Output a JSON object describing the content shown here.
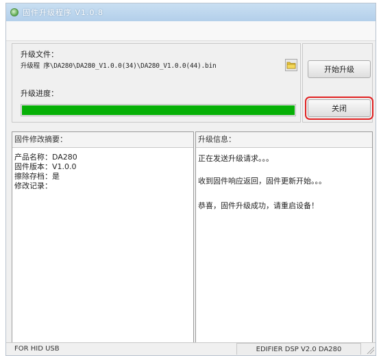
{
  "window": {
    "title": "固件升级程序  V1.0.8"
  },
  "upgrade": {
    "file_label": "升级文件：",
    "file_path": "升级程 序\\DA280\\DA280_V1.0.0(34)\\DA280_V1.0.0(44).bin",
    "progress_label": "升级进度：",
    "progress_fraction": 1.0
  },
  "buttons": {
    "start_label": "开始升级",
    "close_label": "关闭"
  },
  "firmware_summary": {
    "header": "固件修改摘要：",
    "lines": [
      "产品名称：DA280",
      "固件版本：V1.0.0",
      "擦除存档：是",
      "修改记录："
    ]
  },
  "upgrade_info": {
    "header": "升级信息：",
    "lines": [
      "正在发送升级请求。。。",
      "收到固件响应返回，固件更新开始。。。",
      "恭喜，固件升级成功，请重启设备！"
    ]
  },
  "statusbar": {
    "left_text": "FOR HID USB",
    "right_text": "EDIFIER DSP V2.0   DA280"
  },
  "colors": {
    "progress_fill": "#06b006",
    "close_highlight": "#e02020"
  },
  "icons": {
    "title": "app-icon",
    "browse": "folder-icon",
    "resize": "resize-grip-icon"
  }
}
